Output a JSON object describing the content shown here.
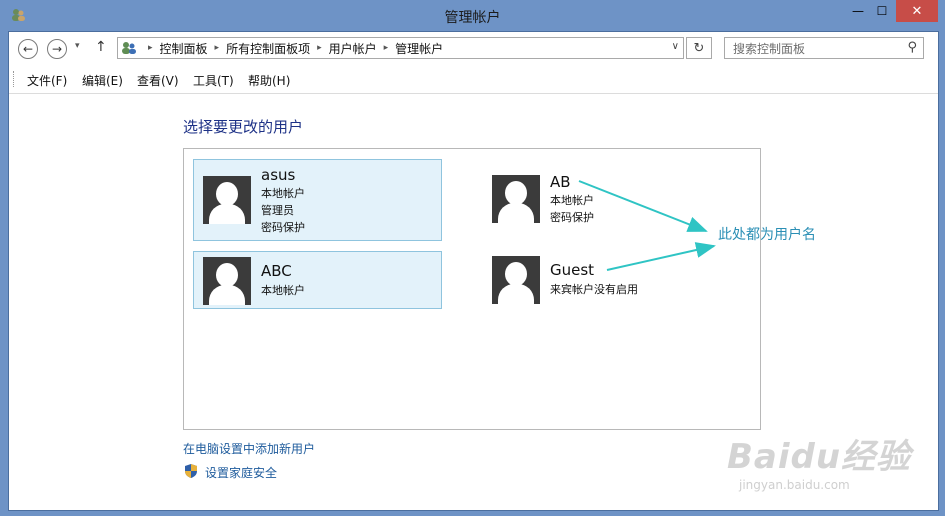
{
  "window": {
    "title": "管理帐户",
    "minimize": "—",
    "maximize": "☐",
    "close": "✕"
  },
  "nav": {
    "breadcrumb": [
      "控制面板",
      "所有控制面板项",
      "用户帐户",
      "管理帐户"
    ],
    "search_placeholder": "搜索控制面板",
    "back": "←",
    "forward": "→",
    "up": "↑",
    "dropdown": "▾",
    "refresh": "↻",
    "search_icon": "⚲",
    "separator": "▸",
    "addr_dropdown": "∨"
  },
  "menu": [
    "文件(F)",
    "编辑(E)",
    "查看(V)",
    "工具(T)",
    "帮助(H)"
  ],
  "content": {
    "heading": "选择要更改的用户",
    "accounts": [
      {
        "name": "asus",
        "details": [
          "本地帐户",
          "管理员",
          "密码保护"
        ]
      },
      {
        "name": "AB",
        "details": [
          "本地帐户",
          "密码保护"
        ]
      },
      {
        "name": "ABC",
        "details": [
          "本地帐户"
        ]
      },
      {
        "name": "Guest",
        "details": [
          "来宾帐户没有启用"
        ]
      }
    ],
    "add_user_link": "在电脑设置中添加新用户",
    "family_safety_link": "设置家庭安全",
    "annotation": "此处都为用户名"
  },
  "watermark": {
    "brand": "Baidu经验",
    "url": "jingyan.baidu.com"
  },
  "colors": {
    "accent": "#1e3287",
    "link": "#1e5b9c",
    "annotation": "#2b8fb5",
    "selected_bg": "#e3f2fa",
    "close_button": "#c74d48"
  }
}
